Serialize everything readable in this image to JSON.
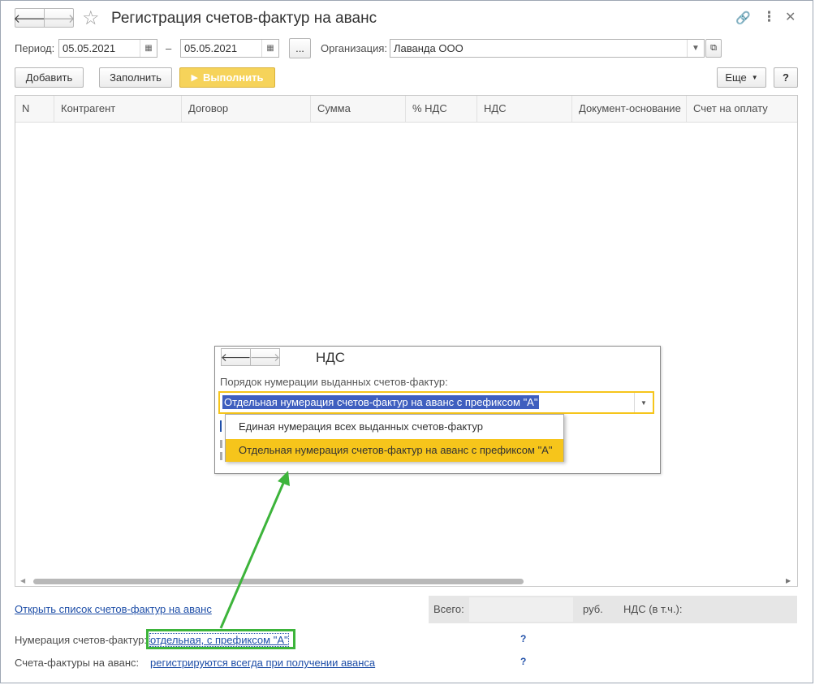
{
  "window": {
    "title": "Регистрация счетов-фактур на аванс"
  },
  "period": {
    "label": "Период:",
    "from": "05.05.2021",
    "dash": "–",
    "to": "05.05.2021",
    "choose": "..."
  },
  "organization": {
    "label": "Организация:",
    "value": "Лаванда ООО"
  },
  "toolbar": {
    "add": "Добавить",
    "fill": "Заполнить",
    "run": "Выполнить",
    "more": "Еще",
    "help": "?"
  },
  "table": {
    "columns": [
      "N",
      "Контрагент",
      "Договор",
      "Сумма",
      "% НДС",
      "НДС",
      "Документ-основание",
      "Счет на оплату"
    ]
  },
  "footer": {
    "open_list": "Открыть список счетов-фактур на аванс",
    "total_label": "Всего:",
    "currency": "руб.",
    "vat_label": "НДС (в т.ч.):",
    "numbering_label": "Нумерация счетов-фактур:",
    "numbering_value": "отдельная, с префиксом \"А\"",
    "numbering_help": "?",
    "invoices_label": "Счета-фактуры на аванс:",
    "invoices_value": "регистрируются всегда при получении аванса",
    "invoices_help": "?"
  },
  "popup": {
    "title": "НДС",
    "field_label": "Порядок нумерации выданных счетов-фактур:",
    "selected": "Отдельная нумерация счетов-фактур на аванс с префиксом \"А\"",
    "options": [
      "Единая нумерация всех выданных счетов-фактур",
      "Отдельная нумерация счетов-фактур на аванс с префиксом \"А\""
    ]
  },
  "colors": {
    "accent_yellow": "#f6c51b",
    "link_blue": "#1f4fa8",
    "annotation_green": "#3db43b",
    "selection_blue": "#3f5fbf"
  }
}
